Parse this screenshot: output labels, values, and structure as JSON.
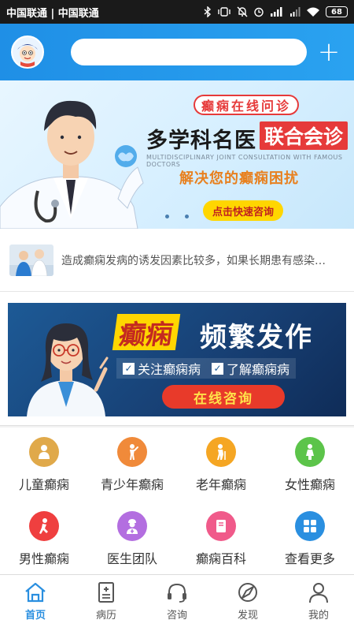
{
  "status_bar": {
    "carrier": "中国联通 | 中国联通",
    "battery": "68"
  },
  "header": {
    "search_placeholder": "",
    "add_label": "+"
  },
  "banner_top": {
    "tag": "癫痫在线问诊",
    "headline": "多学科名医",
    "headline_highlight": "联合会诊",
    "english_sub": "MULTIDISCIPLINARY JOINT CONSULTATION WITH FAMOUS DOCTORS",
    "subtitle": "解决您的癫痫困扰",
    "button": "点击快速咨询"
  },
  "news": {
    "text": "造成癫痫发病的诱发因素比较多，如果长期患有感染…"
  },
  "banner_second": {
    "title_highlight": "癫痫",
    "title_rest": "频繁发作",
    "check1": "关注癫痫病",
    "check2": "了解癫痫病",
    "button": "在线咨询"
  },
  "categories": [
    {
      "label": "儿童癫痫",
      "icon": "child-icon",
      "color": "#e0a94a"
    },
    {
      "label": "青少年癫痫",
      "icon": "teen-icon",
      "color": "#f08a3a"
    },
    {
      "label": "老年癫痫",
      "icon": "elderly-icon",
      "color": "#f5a623"
    },
    {
      "label": "女性癫痫",
      "icon": "female-icon",
      "color": "#5cc44a"
    },
    {
      "label": "男性癫痫",
      "icon": "male-icon",
      "color": "#ef3f3f"
    },
    {
      "label": "医生团队",
      "icon": "doctor-icon",
      "color": "#b36ee0"
    },
    {
      "label": "癫痫百科",
      "icon": "book-icon",
      "color": "#f05a8a"
    },
    {
      "label": "查看更多",
      "icon": "grid-icon",
      "color": "#2a8fe0"
    }
  ],
  "bottom_nav": [
    {
      "label": "首页",
      "icon": "home-icon",
      "active": true
    },
    {
      "label": "病历",
      "icon": "medical-record-icon",
      "active": false
    },
    {
      "label": "咨询",
      "icon": "headset-icon",
      "active": false
    },
    {
      "label": "发现",
      "icon": "compass-icon",
      "active": false
    },
    {
      "label": "我的",
      "icon": "user-icon",
      "active": false
    }
  ],
  "colors": {
    "brand_blue": "#2a8fe0",
    "accent_red": "#e63a3a",
    "accent_yellow": "#ffd600"
  }
}
